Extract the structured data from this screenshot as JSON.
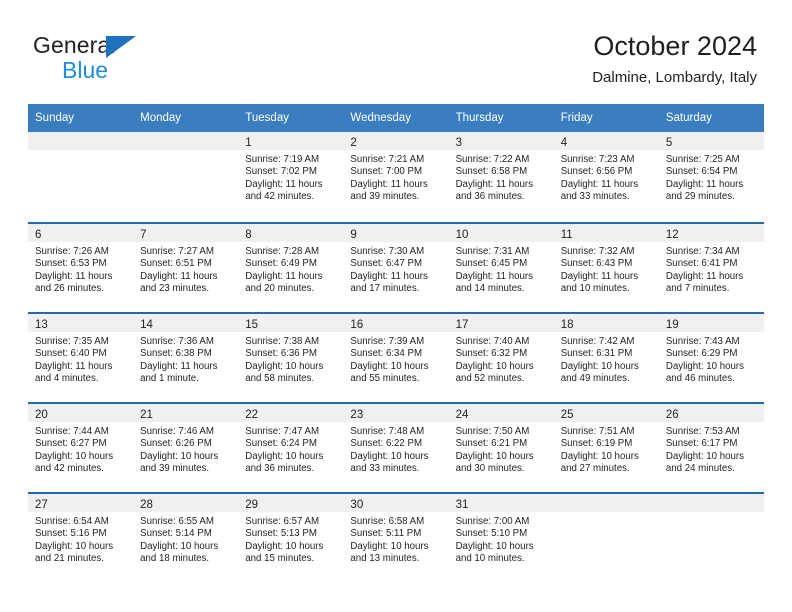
{
  "brand": {
    "name_top": "General",
    "name_bottom": "Blue",
    "triangle_color": "#1f72bd",
    "blue_color": "#1f8ddd"
  },
  "header": {
    "title": "October 2024",
    "subtitle": "Dalmine, Lombardy, Italy"
  },
  "theme": {
    "header_blue": "#3a7ebf",
    "row_rule_blue": "#1f6cb0",
    "daynum_strip": "#f0f0f0",
    "text": "#231f20"
  },
  "weekdays": [
    "Sunday",
    "Monday",
    "Tuesday",
    "Wednesday",
    "Thursday",
    "Friday",
    "Saturday"
  ],
  "labels": {
    "sunrise_prefix": "Sunrise:",
    "sunset_prefix": "Sunset:",
    "daylight_prefix": "Daylight:"
  },
  "weeks": [
    [
      {
        "day": "",
        "empty": true
      },
      {
        "day": "",
        "empty": true
      },
      {
        "day": "1",
        "sunrise": "Sunrise: 7:19 AM",
        "sunset": "Sunset: 7:02 PM",
        "daylight_1": "Daylight: 11 hours",
        "daylight_2": "and 42 minutes."
      },
      {
        "day": "2",
        "sunrise": "Sunrise: 7:21 AM",
        "sunset": "Sunset: 7:00 PM",
        "daylight_1": "Daylight: 11 hours",
        "daylight_2": "and 39 minutes."
      },
      {
        "day": "3",
        "sunrise": "Sunrise: 7:22 AM",
        "sunset": "Sunset: 6:58 PM",
        "daylight_1": "Daylight: 11 hours",
        "daylight_2": "and 36 minutes."
      },
      {
        "day": "4",
        "sunrise": "Sunrise: 7:23 AM",
        "sunset": "Sunset: 6:56 PM",
        "daylight_1": "Daylight: 11 hours",
        "daylight_2": "and 33 minutes."
      },
      {
        "day": "5",
        "sunrise": "Sunrise: 7:25 AM",
        "sunset": "Sunset: 6:54 PM",
        "daylight_1": "Daylight: 11 hours",
        "daylight_2": "and 29 minutes."
      }
    ],
    [
      {
        "day": "6",
        "sunrise": "Sunrise: 7:26 AM",
        "sunset": "Sunset: 6:53 PM",
        "daylight_1": "Daylight: 11 hours",
        "daylight_2": "and 26 minutes."
      },
      {
        "day": "7",
        "sunrise": "Sunrise: 7:27 AM",
        "sunset": "Sunset: 6:51 PM",
        "daylight_1": "Daylight: 11 hours",
        "daylight_2": "and 23 minutes."
      },
      {
        "day": "8",
        "sunrise": "Sunrise: 7:28 AM",
        "sunset": "Sunset: 6:49 PM",
        "daylight_1": "Daylight: 11 hours",
        "daylight_2": "and 20 minutes."
      },
      {
        "day": "9",
        "sunrise": "Sunrise: 7:30 AM",
        "sunset": "Sunset: 6:47 PM",
        "daylight_1": "Daylight: 11 hours",
        "daylight_2": "and 17 minutes."
      },
      {
        "day": "10",
        "sunrise": "Sunrise: 7:31 AM",
        "sunset": "Sunset: 6:45 PM",
        "daylight_1": "Daylight: 11 hours",
        "daylight_2": "and 14 minutes."
      },
      {
        "day": "11",
        "sunrise": "Sunrise: 7:32 AM",
        "sunset": "Sunset: 6:43 PM",
        "daylight_1": "Daylight: 11 hours",
        "daylight_2": "and 10 minutes."
      },
      {
        "day": "12",
        "sunrise": "Sunrise: 7:34 AM",
        "sunset": "Sunset: 6:41 PM",
        "daylight_1": "Daylight: 11 hours",
        "daylight_2": "and 7 minutes."
      }
    ],
    [
      {
        "day": "13",
        "sunrise": "Sunrise: 7:35 AM",
        "sunset": "Sunset: 6:40 PM",
        "daylight_1": "Daylight: 11 hours",
        "daylight_2": "and 4 minutes."
      },
      {
        "day": "14",
        "sunrise": "Sunrise: 7:36 AM",
        "sunset": "Sunset: 6:38 PM",
        "daylight_1": "Daylight: 11 hours",
        "daylight_2": "and 1 minute."
      },
      {
        "day": "15",
        "sunrise": "Sunrise: 7:38 AM",
        "sunset": "Sunset: 6:36 PM",
        "daylight_1": "Daylight: 10 hours",
        "daylight_2": "and 58 minutes."
      },
      {
        "day": "16",
        "sunrise": "Sunrise: 7:39 AM",
        "sunset": "Sunset: 6:34 PM",
        "daylight_1": "Daylight: 10 hours",
        "daylight_2": "and 55 minutes."
      },
      {
        "day": "17",
        "sunrise": "Sunrise: 7:40 AM",
        "sunset": "Sunset: 6:32 PM",
        "daylight_1": "Daylight: 10 hours",
        "daylight_2": "and 52 minutes."
      },
      {
        "day": "18",
        "sunrise": "Sunrise: 7:42 AM",
        "sunset": "Sunset: 6:31 PM",
        "daylight_1": "Daylight: 10 hours",
        "daylight_2": "and 49 minutes."
      },
      {
        "day": "19",
        "sunrise": "Sunrise: 7:43 AM",
        "sunset": "Sunset: 6:29 PM",
        "daylight_1": "Daylight: 10 hours",
        "daylight_2": "and 46 minutes."
      }
    ],
    [
      {
        "day": "20",
        "sunrise": "Sunrise: 7:44 AM",
        "sunset": "Sunset: 6:27 PM",
        "daylight_1": "Daylight: 10 hours",
        "daylight_2": "and 42 minutes."
      },
      {
        "day": "21",
        "sunrise": "Sunrise: 7:46 AM",
        "sunset": "Sunset: 6:26 PM",
        "daylight_1": "Daylight: 10 hours",
        "daylight_2": "and 39 minutes."
      },
      {
        "day": "22",
        "sunrise": "Sunrise: 7:47 AM",
        "sunset": "Sunset: 6:24 PM",
        "daylight_1": "Daylight: 10 hours",
        "daylight_2": "and 36 minutes."
      },
      {
        "day": "23",
        "sunrise": "Sunrise: 7:48 AM",
        "sunset": "Sunset: 6:22 PM",
        "daylight_1": "Daylight: 10 hours",
        "daylight_2": "and 33 minutes."
      },
      {
        "day": "24",
        "sunrise": "Sunrise: 7:50 AM",
        "sunset": "Sunset: 6:21 PM",
        "daylight_1": "Daylight: 10 hours",
        "daylight_2": "and 30 minutes."
      },
      {
        "day": "25",
        "sunrise": "Sunrise: 7:51 AM",
        "sunset": "Sunset: 6:19 PM",
        "daylight_1": "Daylight: 10 hours",
        "daylight_2": "and 27 minutes."
      },
      {
        "day": "26",
        "sunrise": "Sunrise: 7:53 AM",
        "sunset": "Sunset: 6:17 PM",
        "daylight_1": "Daylight: 10 hours",
        "daylight_2": "and 24 minutes."
      }
    ],
    [
      {
        "day": "27",
        "sunrise": "Sunrise: 6:54 AM",
        "sunset": "Sunset: 5:16 PM",
        "daylight_1": "Daylight: 10 hours",
        "daylight_2": "and 21 minutes."
      },
      {
        "day": "28",
        "sunrise": "Sunrise: 6:55 AM",
        "sunset": "Sunset: 5:14 PM",
        "daylight_1": "Daylight: 10 hours",
        "daylight_2": "and 18 minutes."
      },
      {
        "day": "29",
        "sunrise": "Sunrise: 6:57 AM",
        "sunset": "Sunset: 5:13 PM",
        "daylight_1": "Daylight: 10 hours",
        "daylight_2": "and 15 minutes."
      },
      {
        "day": "30",
        "sunrise": "Sunrise: 6:58 AM",
        "sunset": "Sunset: 5:11 PM",
        "daylight_1": "Daylight: 10 hours",
        "daylight_2": "and 13 minutes."
      },
      {
        "day": "31",
        "sunrise": "Sunrise: 7:00 AM",
        "sunset": "Sunset: 5:10 PM",
        "daylight_1": "Daylight: 10 hours",
        "daylight_2": "and 10 minutes."
      },
      {
        "day": "",
        "empty": true
      },
      {
        "day": "",
        "empty": true
      }
    ]
  ]
}
